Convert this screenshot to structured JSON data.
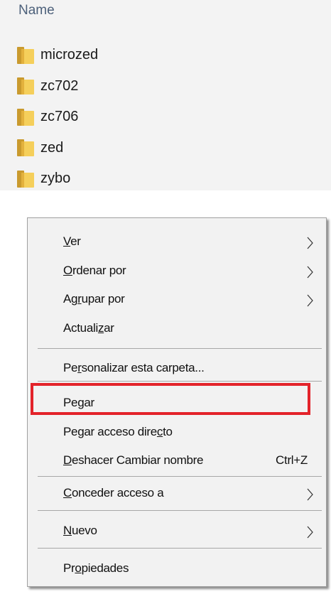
{
  "explorer": {
    "column_header": "Name",
    "folders": [
      {
        "name": "microzed",
        "icon": "folder-icon"
      },
      {
        "name": "zc702",
        "icon": "folder-icon"
      },
      {
        "name": "zc706",
        "icon": "folder-icon"
      },
      {
        "name": "zed",
        "icon": "folder-icon"
      },
      {
        "name": "zybo",
        "icon": "folder-icon"
      }
    ]
  },
  "context_menu": {
    "items": {
      "ver": {
        "pre": "",
        "key": "V",
        "post": "er",
        "submenu": true
      },
      "ordenar": {
        "pre": "",
        "key": "O",
        "post": "rdenar por",
        "submenu": true
      },
      "agrupar": {
        "pre": "Ag",
        "key": "r",
        "post": "upar por",
        "submenu": true
      },
      "actualizar": {
        "pre": "Actuali",
        "key": "z",
        "post": "ar",
        "submenu": false
      },
      "personalizar": {
        "pre": "Pe",
        "key": "r",
        "post": "sonalizar esta carpeta...",
        "submenu": false
      },
      "pegar": {
        "pre": "Pe",
        "key": "g",
        "post": "ar",
        "submenu": false
      },
      "pegar_acceso": {
        "pre": "Pegar acceso dire",
        "key": "c",
        "post": "to",
        "submenu": false
      },
      "deshacer": {
        "pre": "",
        "key": "D",
        "post": "eshacer Cambiar nombre",
        "shortcut": "Ctrl+Z",
        "submenu": false
      },
      "conceder": {
        "pre": "",
        "key": "C",
        "post": "onceder acceso a",
        "submenu": true
      },
      "nuevo": {
        "pre": "",
        "key": "N",
        "post": "uevo",
        "submenu": true
      },
      "propiedades": {
        "pre": "Pr",
        "key": "o",
        "post": "piedades",
        "submenu": false
      }
    },
    "highlight_color": "#e3232a"
  }
}
